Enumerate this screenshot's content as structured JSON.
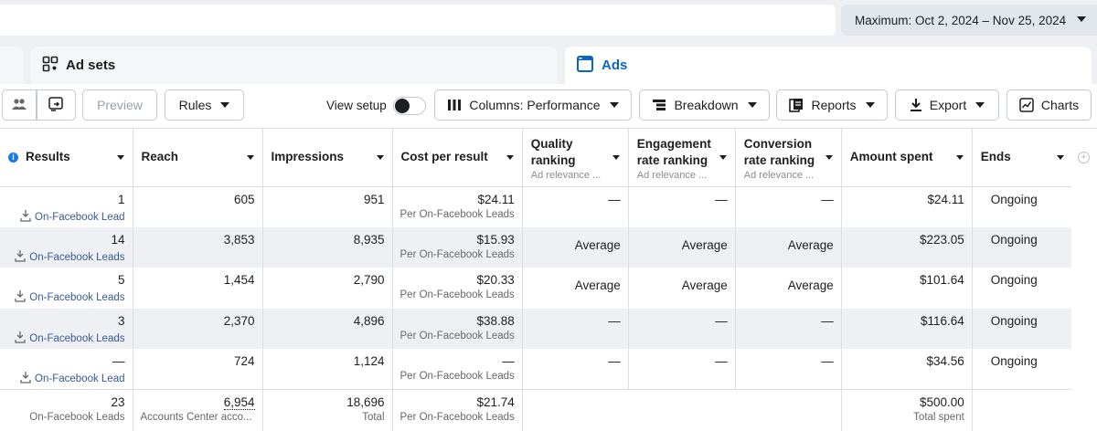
{
  "date_range": {
    "label": "Maximum: Oct 2, 2024 – Nov 25, 2024"
  },
  "tabs": [
    {
      "label": "",
      "icon": "campaigns-icon"
    },
    {
      "label": "Ad sets",
      "icon": "grid-icon"
    },
    {
      "label": "Ads",
      "icon": "ad-window-icon",
      "active": true
    }
  ],
  "toolbar": {
    "preview": "Preview",
    "rules": "Rules",
    "view_setup": "View setup",
    "columns": "Columns: Performance",
    "breakdown": "Breakdown",
    "reports": "Reports",
    "export": "Export",
    "charts": "Charts"
  },
  "columns": [
    {
      "label": "Results",
      "sub": ""
    },
    {
      "label": "Reach",
      "sub": ""
    },
    {
      "label": "Impressions",
      "sub": ""
    },
    {
      "label": "Cost per result",
      "sub": ""
    },
    {
      "label": "Quality ranking",
      "line1": "Quality",
      "line2": "ranking",
      "sub": "Ad relevance ..."
    },
    {
      "label": "Engagement rate ranking",
      "line1": "Engagement",
      "line2": "rate ranking",
      "sub": "Ad relevance ..."
    },
    {
      "label": "Conversion rate ranking",
      "line1": "Conversion",
      "line2": "rate ranking",
      "sub": "Ad relevance ..."
    },
    {
      "label": "Amount spent",
      "sub": ""
    },
    {
      "label": "Ends",
      "sub": ""
    }
  ],
  "rows": [
    {
      "results": "1",
      "result_type": "On-Facebook Lead",
      "reach": "605",
      "impressions": "951",
      "cost": "$24.11",
      "cost_sub": "Per On-Facebook Leads",
      "quality": "—",
      "engagement": "—",
      "conversion": "—",
      "spent": "$24.11",
      "ends": "Ongoing"
    },
    {
      "results": "14",
      "result_type": "On-Facebook Leads",
      "reach": "3,853",
      "impressions": "8,935",
      "cost": "$15.93",
      "cost_sub": "Per On-Facebook Leads",
      "quality": "Average",
      "engagement": "Average",
      "conversion": "Average",
      "spent": "$223.05",
      "ends": "Ongoing"
    },
    {
      "results": "5",
      "result_type": "On-Facebook Leads",
      "reach": "1,454",
      "impressions": "2,790",
      "cost": "$20.33",
      "cost_sub": "Per On-Facebook Leads",
      "quality": "Average",
      "engagement": "Average",
      "conversion": "Average",
      "spent": "$101.64",
      "ends": "Ongoing"
    },
    {
      "results": "3",
      "result_type": "On-Facebook Leads",
      "reach": "2,370",
      "impressions": "4,896",
      "cost": "$38.88",
      "cost_sub": "Per On-Facebook Leads",
      "quality": "—",
      "engagement": "—",
      "conversion": "—",
      "spent": "$116.64",
      "ends": "Ongoing"
    },
    {
      "results": "—",
      "result_type": "On-Facebook Lead",
      "reach": "724",
      "impressions": "1,124",
      "cost": "—",
      "cost_sub": "Per On-Facebook Leads",
      "quality": "—",
      "engagement": "—",
      "conversion": "—",
      "spent": "$34.56",
      "ends": "Ongoing"
    }
  ],
  "totals": {
    "results": "23",
    "results_sub": "On-Facebook Leads",
    "reach": "6,954",
    "reach_sub": "Accounts Center acco...",
    "impressions": "18,696",
    "impressions_sub": "Total",
    "cost": "$21.74",
    "cost_sub": "Per On-Facebook Leads",
    "spent": "$500.00",
    "spent_sub": "Total spent"
  },
  "colors": {
    "accent": "#0a66c2",
    "link": "#385898",
    "row_alt": "#eef0f4"
  }
}
